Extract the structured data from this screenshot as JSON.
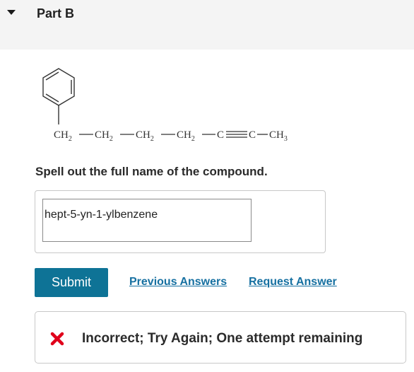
{
  "part": {
    "title": "Part B",
    "toggle_icon": "caret-down-icon"
  },
  "structure": {
    "chain": [
      "CH2",
      "CH2",
      "CH2",
      "CH2",
      "C",
      "C",
      "CH3"
    ],
    "bonds": [
      "single",
      "single",
      "single",
      "single",
      "triple",
      "single"
    ],
    "substituent": "benzene-ring"
  },
  "question": {
    "prompt": "Spell out the full name of the compound."
  },
  "answer": {
    "value": "hept-5-yn-1-ylbenzene"
  },
  "actions": {
    "submit_label": "Submit",
    "previous_answers_label": "Previous Answers",
    "request_answer_label": "Request Answer"
  },
  "feedback": {
    "icon": "x-mark-icon",
    "icon_color": "#e0001b",
    "message": "Incorrect; Try Again; One attempt remaining"
  },
  "colors": {
    "accent": "#0e7396",
    "link": "#1670a1"
  }
}
